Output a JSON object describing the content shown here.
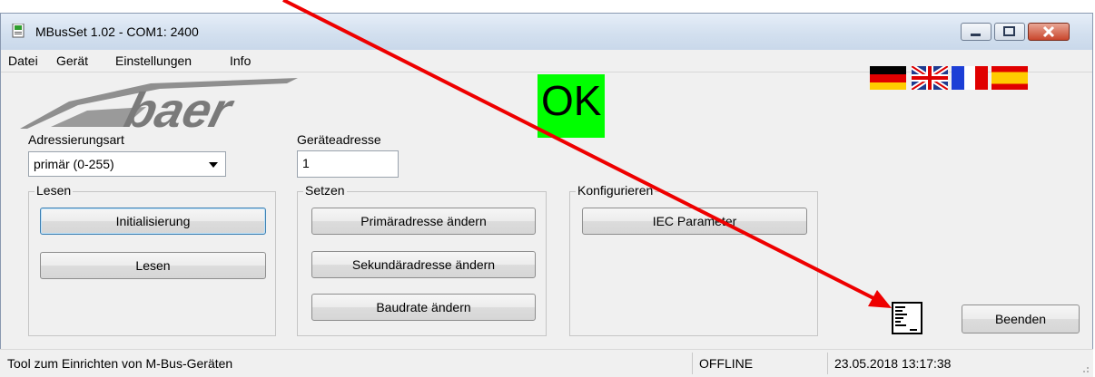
{
  "window": {
    "title": "MBusSet 1.02 - COM1: 2400"
  },
  "menu": [
    "Datei",
    "Gerät",
    "Einstellungen",
    "Info"
  ],
  "logo_text": "baer",
  "status_indicator": {
    "text": "OK",
    "color": "#00ff00"
  },
  "flags": [
    "de-flag-icon",
    "gb-flag-icon",
    "fr-flag-icon",
    "es-flag-icon"
  ],
  "addressing": {
    "label": "Adressierungsart",
    "value": "primär (0-255)"
  },
  "device_address": {
    "label": "Geräteadresse",
    "value": "1"
  },
  "groups": {
    "lesen": {
      "title": "Lesen",
      "buttons": [
        "Initialisierung",
        "Lesen"
      ]
    },
    "setzen": {
      "title": "Setzen",
      "buttons": [
        "Primäradresse ändern",
        "Sekundäradresse ändern",
        "Baudrate ändern"
      ]
    },
    "konfigurieren": {
      "title": "Konfigurieren",
      "buttons": [
        "IEC Parameter"
      ]
    }
  },
  "exit_button": "Beenden",
  "log_icon": "log-window-icon",
  "statusbar": {
    "description": "Tool zum Einrichten von M-Bus-Geräten",
    "connection": "OFFLINE",
    "datetime": "23.05.2018 13:17:38"
  },
  "annotation_color": "#ee0000"
}
